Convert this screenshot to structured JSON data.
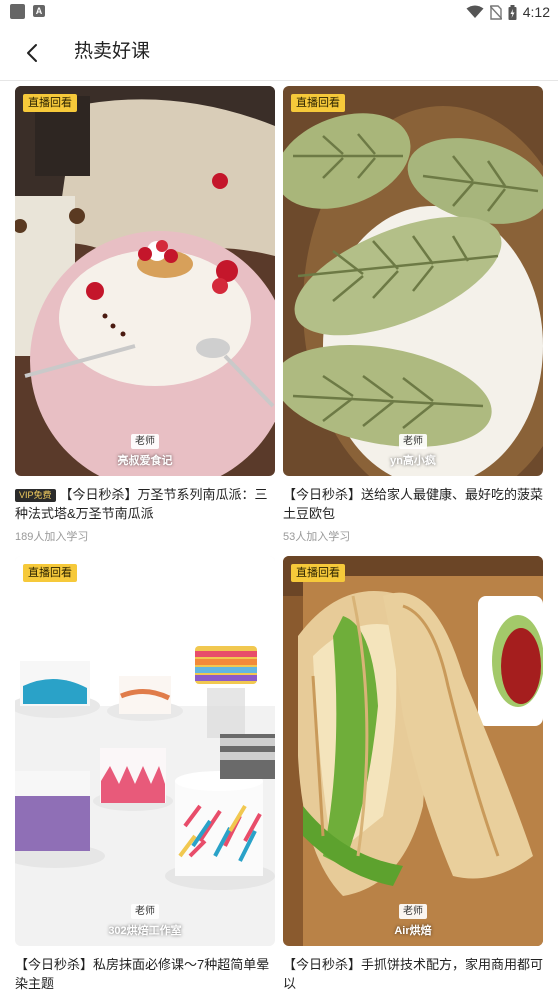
{
  "status_bar": {
    "time": "4:12",
    "notification_icon": "A"
  },
  "header": {
    "title": "热卖好课"
  },
  "courses": [
    {
      "badge": "直播回看",
      "teacher_role": "老师",
      "teacher_name": "亮叔爱食记",
      "vip": "VIP免费",
      "title": "【今日秒杀】万圣节系列南瓜派：三种法式塔&万圣节南瓜派",
      "learners": "189人加入学习"
    },
    {
      "badge": "直播回看",
      "teacher_role": "老师",
      "teacher_name": "yn高小疯",
      "title": "【今日秒杀】送给家人最健康、最好吃的菠菜土豆欧包",
      "learners": "53人加入学习"
    },
    {
      "badge": "直播回看",
      "teacher_role": "老师",
      "teacher_name": "302烘焙工作室",
      "title": "【今日秒杀】私房抹面必修课～7种超简单晕染主题"
    },
    {
      "badge": "直播回看",
      "teacher_role": "老师",
      "teacher_name": "Air烘焙",
      "title": "【今日秒杀】手抓饼技术配方，家用商用都可以"
    }
  ]
}
